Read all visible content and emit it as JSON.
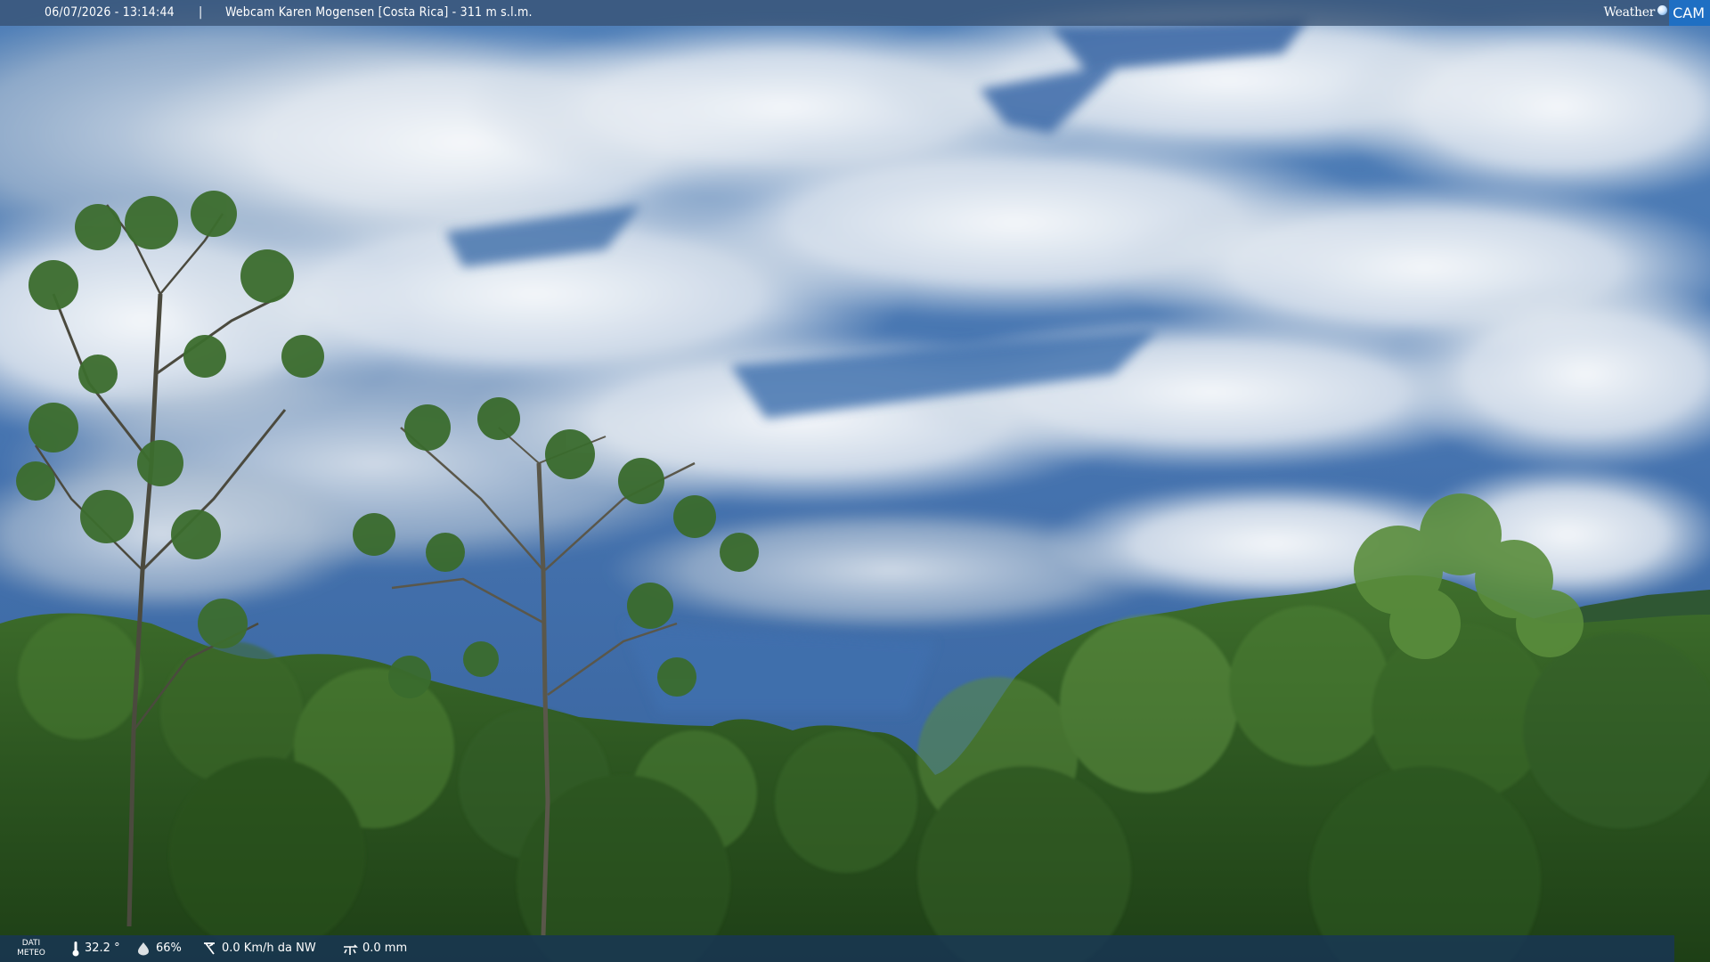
{
  "header": {
    "datetime": "06/07/2026 - 13:14:44",
    "separator": "|",
    "title": "Webcam Karen Mogensen [Costa Rica] - 311 m s.l.m."
  },
  "brand": {
    "weather_text": "Weather",
    "cam_text": "CAM",
    "accent_color": "#1f6fc3"
  },
  "weather": {
    "label_line1": "DATI",
    "label_line2": "METEO",
    "temperature": "32.2 °",
    "humidity": "66%",
    "wind": "0.0 Km/h da NW",
    "rain": "0.0 mm",
    "icons": [
      "thermometer-icon",
      "humidity-drop-icon",
      "wind-vane-icon",
      "rain-gauge-icon"
    ]
  },
  "scene": {
    "sky_color": "#3d6fae",
    "cloud_color": "#eef2f6",
    "forest_color": "#2f5a22"
  }
}
